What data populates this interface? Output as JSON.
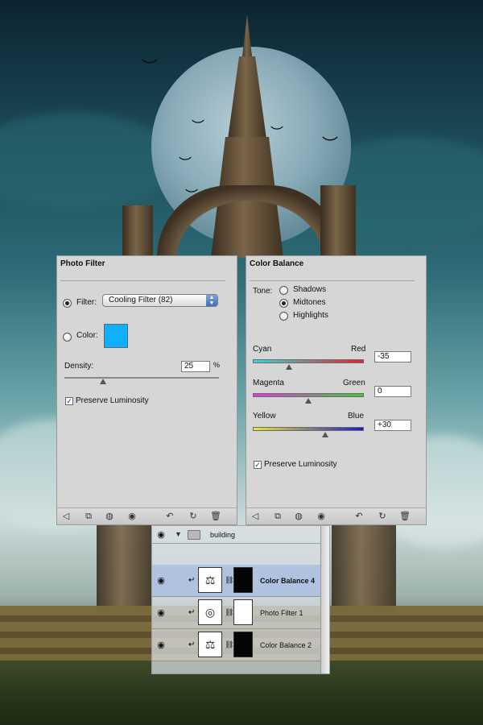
{
  "photo_filter": {
    "title": "Photo Filter",
    "filter_label": "Filter:",
    "filter_value": "Cooling Filter (82)",
    "color_label": "Color:",
    "color_swatch": "#0fb0ff",
    "density_label": "Density:",
    "density_value": "25",
    "density_unit": "%",
    "density_fraction": 0.25,
    "preserve_luminosity_label": "Preserve Luminosity",
    "preserve_luminosity_checked": true,
    "filter_selected": true
  },
  "color_balance": {
    "title": "Color Balance",
    "tone_label": "Tone:",
    "tones": [
      {
        "label": "Shadows",
        "selected": false
      },
      {
        "label": "Midtones",
        "selected": true
      },
      {
        "label": "Highlights",
        "selected": false
      }
    ],
    "sliders": [
      {
        "left": "Cyan",
        "right": "Red",
        "value": "-35",
        "numeric": -35,
        "gradient": [
          "#35d8df",
          "#e8202a"
        ]
      },
      {
        "left": "Magenta",
        "right": "Green",
        "value": "0",
        "numeric": 0,
        "gradient": [
          "#e03ad8",
          "#3ccc3a"
        ]
      },
      {
        "left": "Yellow",
        "right": "Blue",
        "value": "+30",
        "numeric": 30,
        "gradient": [
          "#f0e630",
          "#1a1ad0"
        ]
      }
    ],
    "preserve_luminosity_label": "Preserve Luminosity",
    "preserve_luminosity_checked": true
  },
  "layers": {
    "group_name": "building",
    "items": [
      {
        "name": "Color Balance 4",
        "selected": true,
        "mask": "black"
      },
      {
        "name": "Photo Filter 1",
        "selected": false,
        "mask": "white"
      },
      {
        "name": "Color Balance 2",
        "selected": false,
        "mask": "black"
      }
    ]
  },
  "icons": {
    "footer": [
      "back-arrow-icon",
      "clip-icon",
      "visibility-toggle-icon",
      "eye-icon",
      "reset-icon",
      "refresh-icon",
      "trash-icon"
    ],
    "folder": "folder-icon",
    "eye": "eye-icon",
    "link": "chain-link-icon"
  }
}
